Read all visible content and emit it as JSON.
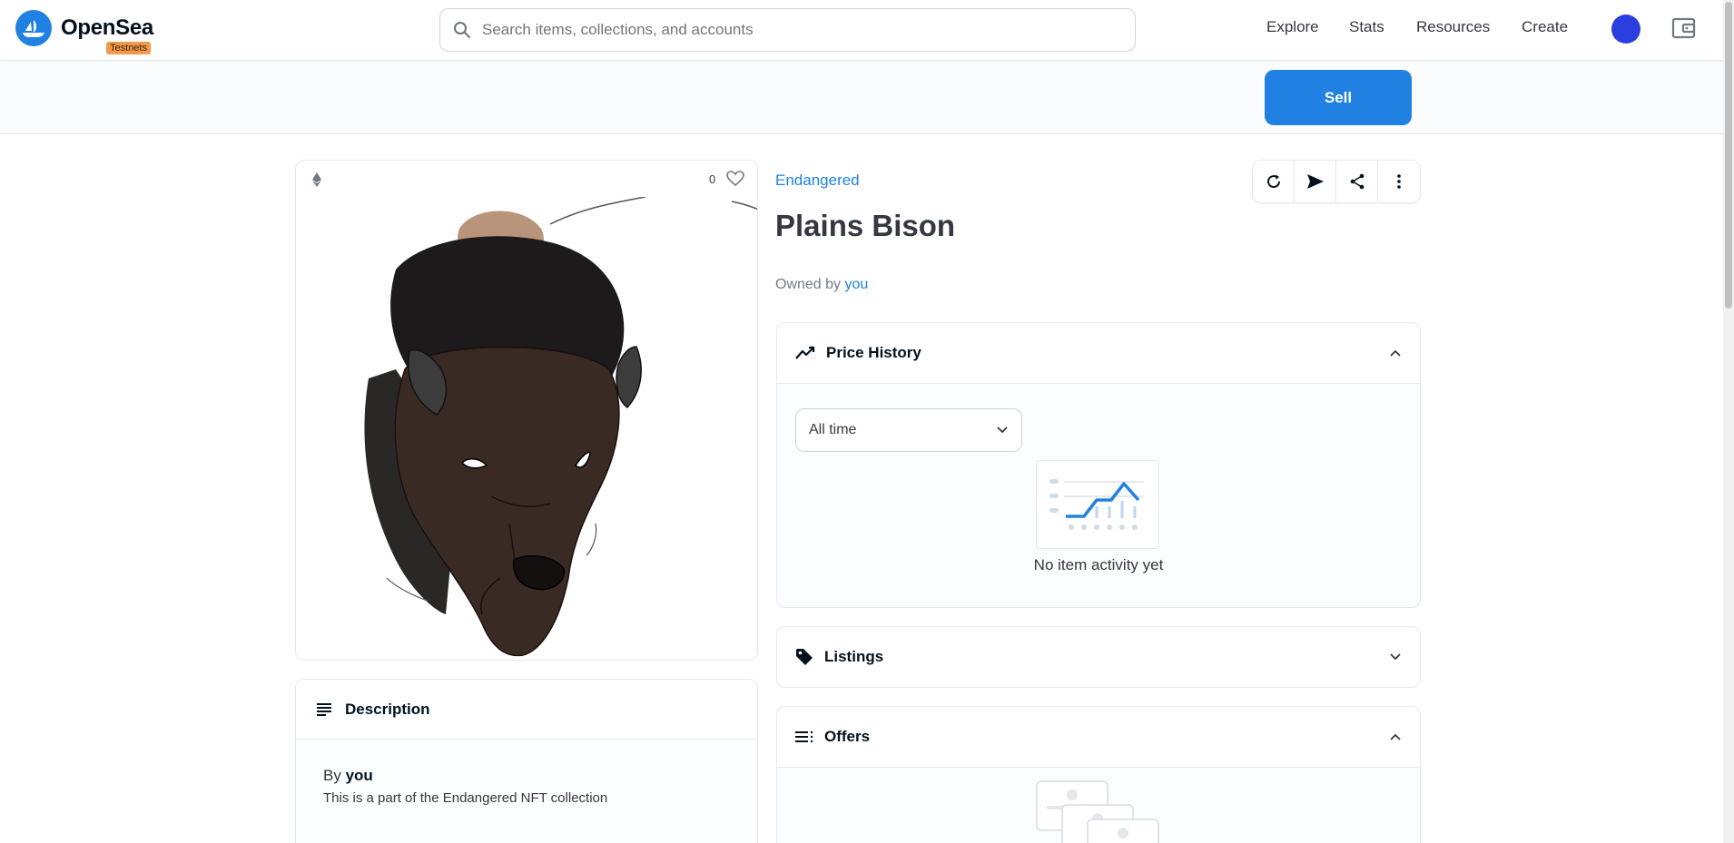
{
  "header": {
    "logo_text": "OpenSea",
    "badge": "Testnets",
    "search_placeholder": "Search items, collections, and accounts",
    "nav": [
      "Explore",
      "Stats",
      "Resources",
      "Create"
    ]
  },
  "sellbar": {
    "sell_label": "Sell"
  },
  "item": {
    "favorites": "0",
    "collection": "Endangered",
    "title": "Plains Bison",
    "owned_prefix": "Owned by",
    "owner": "you"
  },
  "description": {
    "heading": "Description",
    "by_prefix": "By",
    "creator": "you",
    "text": "This is a part of the Endangered NFT collection"
  },
  "price_history": {
    "heading": "Price History",
    "filter_value": "All time",
    "empty_text": "No item activity yet"
  },
  "listings": {
    "heading": "Listings"
  },
  "offers": {
    "heading": "Offers"
  },
  "colors": {
    "accent": "#2081e2",
    "badge": "#f2994a"
  }
}
